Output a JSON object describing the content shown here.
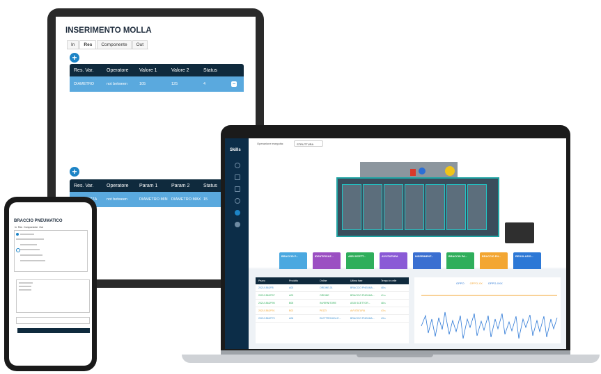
{
  "tablet": {
    "title": "INSERIMENTO MOLLA",
    "tabs": [
      "In",
      "Res",
      "Componente",
      "Out"
    ],
    "active_tab": "Res",
    "table1": {
      "headers": [
        "Res. Var.",
        "Operatore",
        "Valore 1",
        "Valore 2",
        "Status"
      ],
      "row": [
        "DIAMETRO",
        "not between",
        "105",
        "125",
        "4"
      ]
    },
    "table2": {
      "headers": [
        "Res. Var.",
        "Operatore",
        "Param 1",
        "Param 2",
        "Status"
      ],
      "row": [
        "LUNGHEZZA",
        "not between",
        "DIAMETRO MIN",
        "DIAMETRO MAX",
        "15"
      ]
    }
  },
  "phone": {
    "title": "BRACCIO PNEUMATICO",
    "tabs": [
      "In",
      "Res",
      "Componente",
      "Out"
    ]
  },
  "laptop": {
    "logo": "Skills",
    "filter_label": "Operazione eseguita:",
    "filter_chip": "STRUTTURA X/SEMA",
    "stations": [
      {
        "name": "BRACCIO P...",
        "color": "#4aa8e0"
      },
      {
        "name": "IDENTIFICAZ...",
        "color": "#9b4fc2"
      },
      {
        "name": "ASSI SCETT...",
        "color": "#2fae5b"
      },
      {
        "name": "AVVITATURA",
        "color": "#8a5ad6"
      },
      {
        "name": "INSERIMENT...",
        "color": "#3a6fd1"
      },
      {
        "name": "BRACCIO PA...",
        "color": "#2fae5b"
      },
      {
        "name": "BRACCIO PN...",
        "color": "#f3a632"
      },
      {
        "name": "REGOLAZIO...",
        "color": "#2c78d6"
      }
    ],
    "table_headers": [
      "Pezzo",
      "Prodotto",
      "Ordine",
      "Ultima fase",
      "Tempo in celle"
    ],
    "table_rows": [
      [
        "2021/1562/F8",
        "A03",
        "ORDINE-01",
        "BRACCIO PNEUMA...",
        "48 s"
      ],
      [
        "2021/1562/F97",
        "A03",
        "ORDINE",
        "BRACCIO PNEUMA...",
        "41 s"
      ],
      [
        "2021/1562/F95",
        "B05",
        "INVERNITORE",
        "ASSI SCETTOR...",
        "48 s"
      ],
      [
        "2021/1562/F91",
        "B02",
        "PEZZI",
        "AVVITATURA",
        "43 s"
      ],
      [
        "2021/1562/F70",
        "A06",
        "ELETTRONICA E...",
        "BRACCIO PNEUMA...",
        "43 s"
      ]
    ],
    "chart_legend": [
      "OPPO",
      "OPPO-XX",
      "OPPO-XXX"
    ]
  },
  "colors": {
    "navy": "#0f2a3d",
    "accent": "#1d84c6",
    "row_blue": "#5aa9de"
  }
}
